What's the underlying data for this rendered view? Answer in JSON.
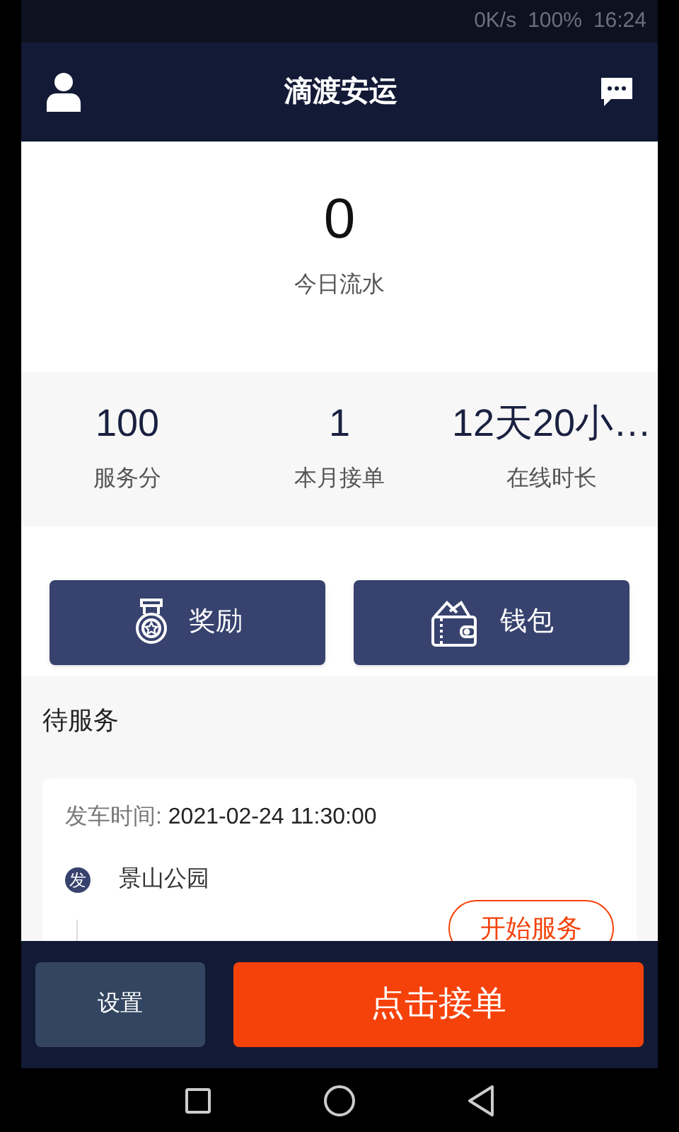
{
  "status_bar": {
    "speed": "0K/s",
    "battery": "100%",
    "time": "16:24"
  },
  "header": {
    "title": "滴渡安运"
  },
  "today": {
    "value": "0",
    "label": "今日流水"
  },
  "stats": [
    {
      "value": "100",
      "label": "服务分"
    },
    {
      "value": "1",
      "label": "本月接单"
    },
    {
      "value": "12天20小…",
      "label": "在线时长"
    }
  ],
  "actions": [
    {
      "kind": "medal",
      "label": "奖励"
    },
    {
      "kind": "wallet",
      "label": "钱包"
    }
  ],
  "pending": {
    "title": "待服务",
    "order": {
      "time_label": "发车时间:",
      "time": "2021-02-24 11:30:00",
      "start_badge": "发",
      "start": "景山公园",
      "action": "开始服务"
    }
  },
  "bottom": {
    "settings": "设置",
    "accept": "点击接单"
  }
}
